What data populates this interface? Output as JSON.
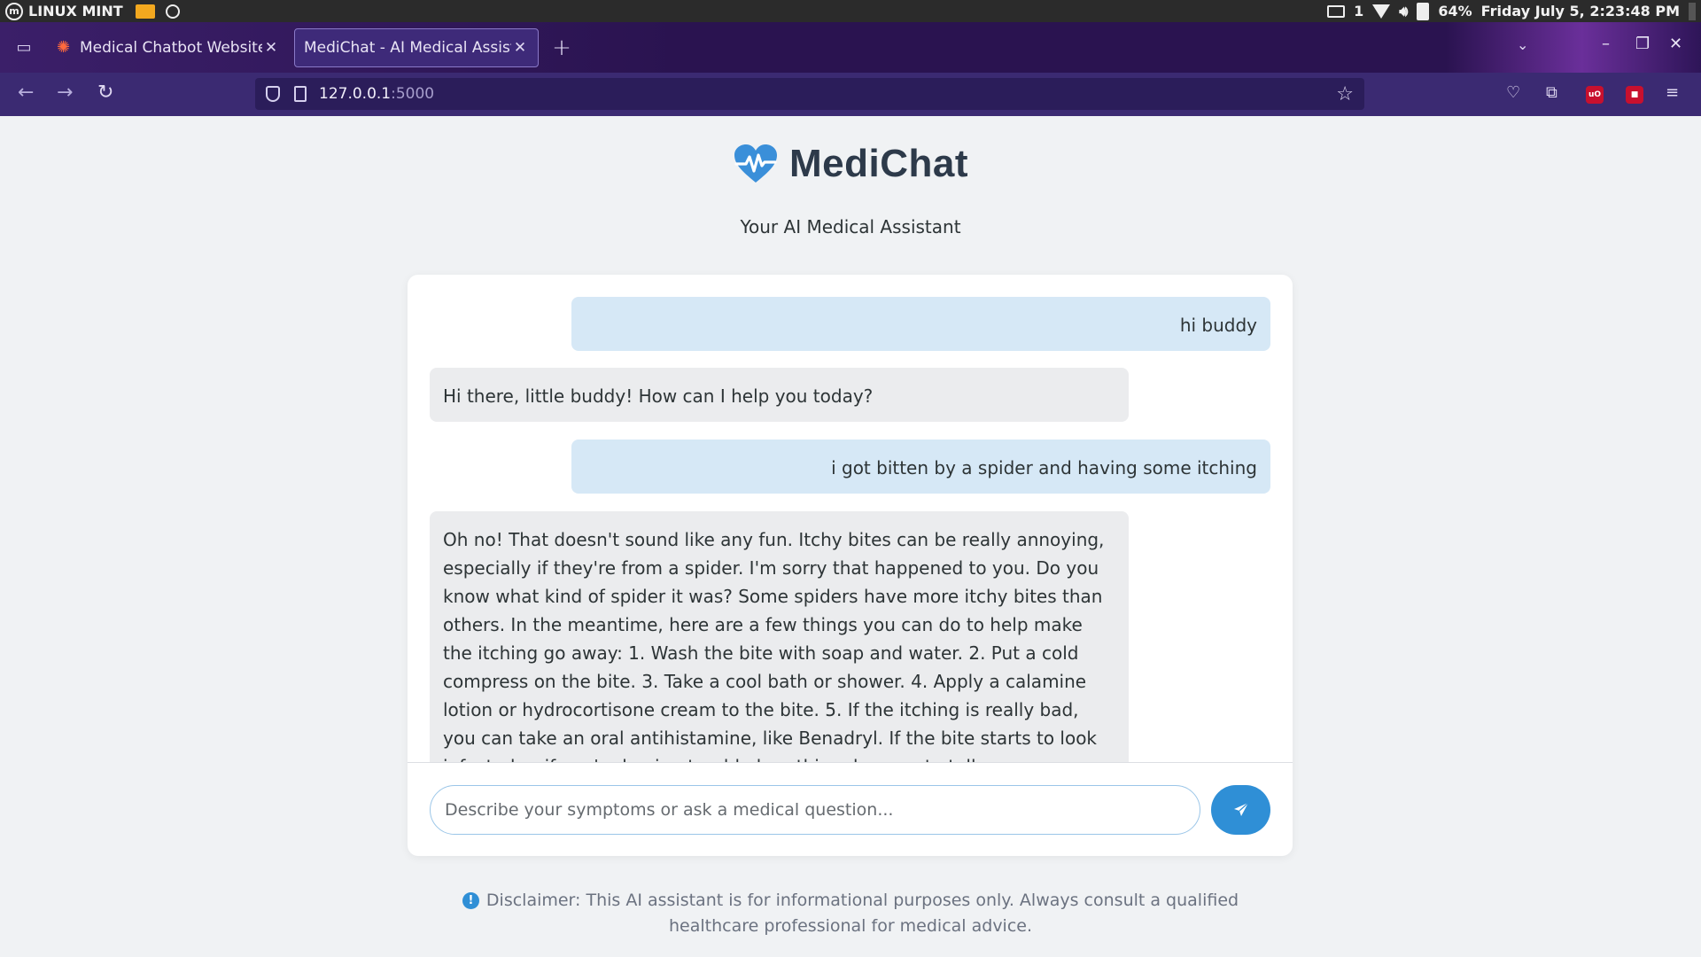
{
  "system_bar": {
    "os_label": "LINUX MINT",
    "printer_count": "1",
    "battery": "64%",
    "datetime": "Friday July  5,  2:23:48 PM"
  },
  "browser": {
    "tabs": [
      {
        "title": "Medical Chatbot Website [",
        "active": false,
        "icon": "spark-favicon-icon"
      },
      {
        "title": "MediChat - AI Medical Assista",
        "active": true,
        "icon": ""
      }
    ],
    "url_host": "127.0.0.1",
    "url_port": ":5000"
  },
  "app": {
    "name": "MediChat",
    "tagline": "Your AI Medical Assistant",
    "brand_color": "#3a8fd9",
    "messages": [
      {
        "role": "user",
        "text": "hi buddy"
      },
      {
        "role": "bot",
        "text": "Hi there, little buddy! How can I help you today?"
      },
      {
        "role": "user",
        "text": "i got bitten by a spider and having some itching"
      },
      {
        "role": "bot",
        "text": "Oh no! That doesn't sound like any fun. Itchy bites can be really annoying, especially if they're from a spider. I'm sorry that happened to you. Do you know what kind of spider it was? Some spiders have more itchy bites than others. In the meantime, here are a few things you can do to help make the itching go away: 1. Wash the bite with soap and water. 2. Put a cold compress on the bite. 3. Take a cool bath or shower. 4. Apply a calamine lotion or hydrocortisone cream to the bite. 5. If the itching is really bad, you can take an oral antihistamine, like Benadryl. If the bite starts to look infected or if you're having trouble breathing, be sure to tell a grown-up."
      }
    ],
    "input_placeholder": "Describe your symptoms or ask a medical question...",
    "input_value": "",
    "disclaimer": "Disclaimer: This AI assistant is for informational purposes only. Always consult a qualified healthcare professional for medical advice."
  }
}
